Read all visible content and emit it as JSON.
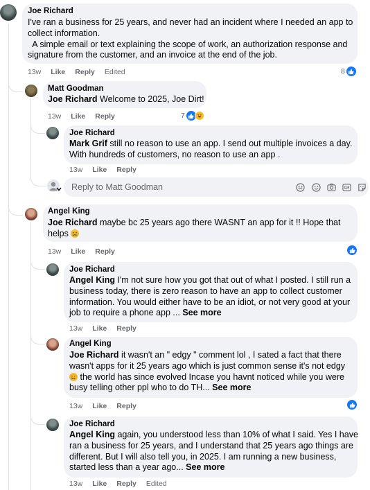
{
  "comments": [
    {
      "author": "Joe Richard",
      "text_lines": [
        "I've ran a business for 25 years, and never had an incident where I needed an app to",
        "collect information.",
        "  A simple email or text explaining the scope of work, an authorization response and",
        "signature from the customer, and an invoice at the end of the job."
      ],
      "time": "13w",
      "like": "Like",
      "reply": "Reply",
      "edited": "Edited",
      "reaction_count": "8"
    },
    {
      "author": "Matt Goodman",
      "mention": "Joe Richard",
      "text": " Welcome to 2025, Joe Dirt!",
      "time": "13w",
      "like": "Like",
      "reply": "Reply",
      "reaction_count": "7"
    },
    {
      "author": "Joe Richard",
      "mention": "Mark Grif",
      "line1": " still no reason to use an app. I send out multiple invoices a day.",
      "line2": "With hundreds of customers, no reason to use an app .",
      "time": "13w",
      "like": "Like",
      "reply": "Reply"
    },
    {
      "author": "Angel King",
      "mention": "Joe Richard",
      "line1": " maybe bc 25 years ago there WASNT an app for it !! Hope that",
      "line2": "helps",
      "time": "13w",
      "like": "Like",
      "reply": "Reply"
    },
    {
      "author": "Joe Richard",
      "mention": "Angel King",
      "line1": " I'm not sure how you got that out of what I posted. I still run a",
      "line2": "business today, there is zero reason to have an app to collect customer",
      "line3": "information. You would either have to be an idiot, or not very good at your",
      "line4": "job to require a phone app ...",
      "see_more": "See more",
      "time": "13w",
      "like": "Like",
      "reply": "Reply"
    },
    {
      "author": "Angel King",
      "mention": "Joe Richard",
      "line1": " it wasn't an \" edgy \" comment lol , I sated a fact that there",
      "line2": "wasn't apps for it 25 years ago which is just common sense it's not edgy",
      "line3": " the world has since evolved Incase you havnt noticed while you were",
      "line4": "busy telling other ppl who to do TH...",
      "see_more": "See more",
      "time": "13w",
      "like": "Like",
      "reply": "Reply"
    },
    {
      "author": "Joe Richard",
      "mention": "Angel King",
      "line1": " again, you understood less than 10% of what I said. Yes I have",
      "line2": "ran a business for 25 years, and I understand that 25 years ago things are",
      "line3": "different. But I will also tell you, in 2025. I am running a new business,",
      "line4": "started less than a year ago...",
      "see_more": "See more",
      "time": "13w",
      "like": "Like",
      "reply": "Reply",
      "edited": "Edited"
    }
  ],
  "reply_box": {
    "placeholder": "Reply to Matt Goodman"
  },
  "icons": {
    "like": "like-reaction-icon",
    "haha": "haha-reaction-icon",
    "cry": "crying-emoji-icon",
    "tools": [
      "avatar-sticker-icon",
      "emoji-icon",
      "camera-icon",
      "gif-icon",
      "sticker-icon"
    ]
  },
  "colors": {
    "accent": "#1877f2",
    "bubble": "#f0f2f5",
    "meta": "#65676b"
  }
}
